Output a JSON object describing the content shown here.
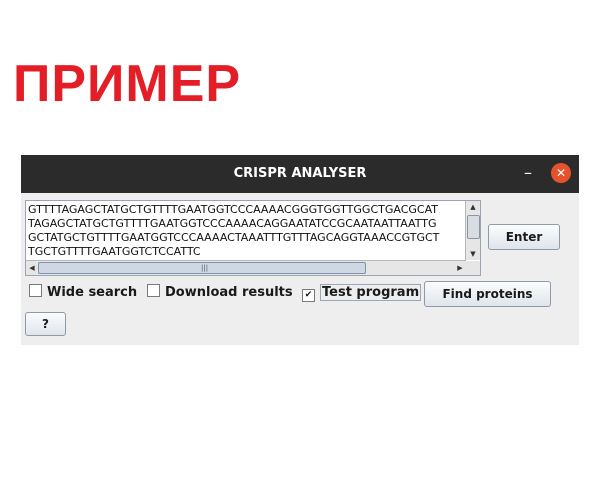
{
  "banner": {
    "text": "ПРИМЕР",
    "color": "#e41e26"
  },
  "window": {
    "title": "CRISPR ANALYSER",
    "minimize_glyph": "–",
    "close_glyph": "✕",
    "close_color": "#e5532d"
  },
  "sequence_input": {
    "lines": [
      "GTTTTAGAGCTATGCTGTTTTGAATGGTCCCAAAACGGGTGGTTGGCTGACGCAT",
      "TAGAGCTATGCTGTTTTGAATGGTCCCAAAACAGGAATATCCGCAATAATTAATTG",
      "GCTATGCTGTTTTGAATGGTCCCAAAACTAAATTTGTTTAGCAGGTAAACCGTGCT",
      "TGCTGTTTTGAATGGTCTCCATTC"
    ]
  },
  "buttons": {
    "enter": "Enter",
    "find_proteins": "Find proteins",
    "help": "?"
  },
  "options": {
    "wide_search": {
      "label": "Wide search",
      "checked": false
    },
    "download_results": {
      "label": "Download results",
      "checked": false
    },
    "test_program": {
      "label": "Test program",
      "checked": true
    }
  },
  "icons": {
    "scroll_up": "▲",
    "scroll_down": "▼",
    "scroll_left": "◀",
    "scroll_right": "▶",
    "grip": "|||",
    "check": "✔"
  }
}
